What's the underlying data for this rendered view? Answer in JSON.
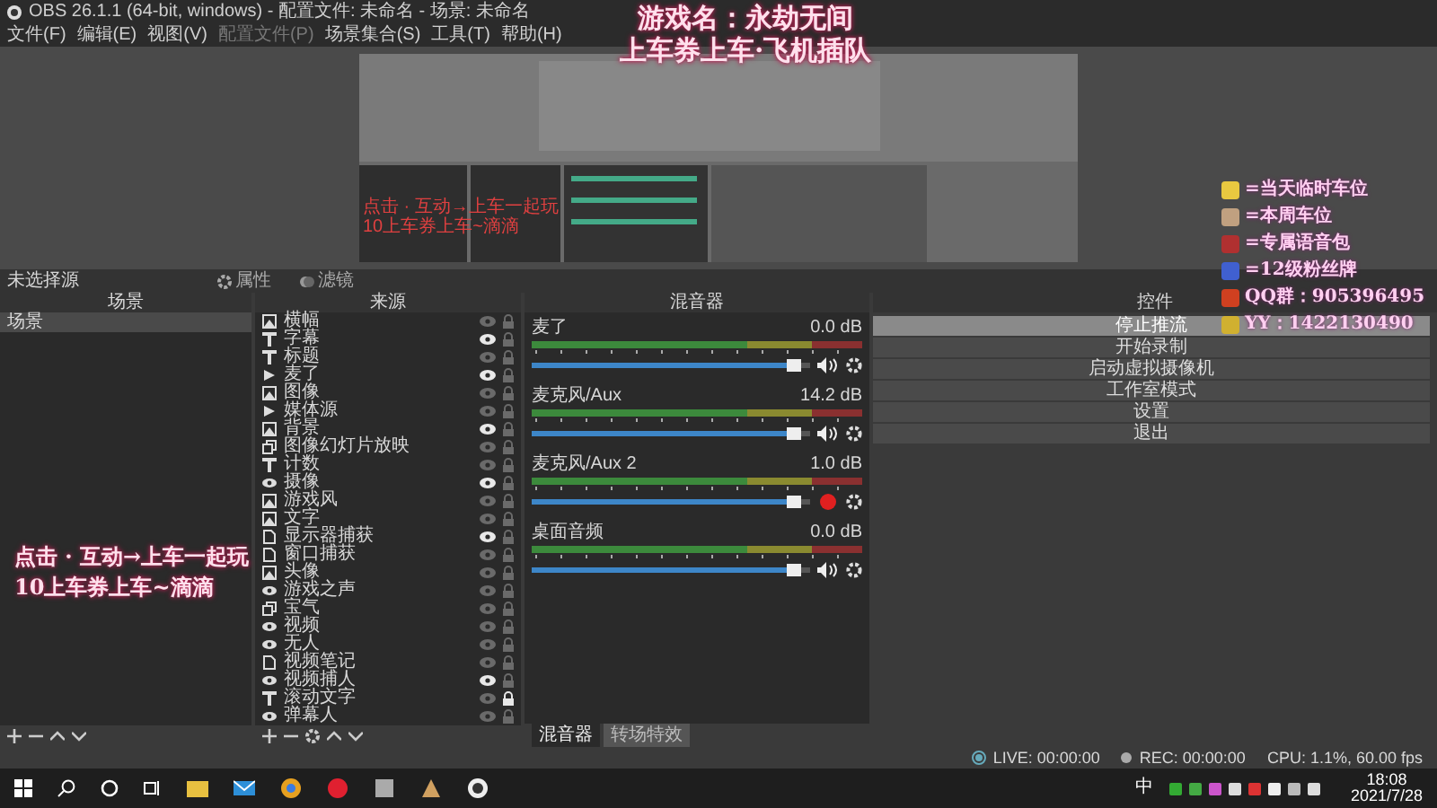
{
  "window": {
    "title": "OBS 26.1.1 (64-bit, windows) - 配置文件: 未命名 - 场景: 未命名"
  },
  "menu": [
    {
      "label": "文件(F)",
      "disabled": false
    },
    {
      "label": "编辑(E)",
      "disabled": false
    },
    {
      "label": "视图(V)",
      "disabled": false
    },
    {
      "label": "配置文件(P)",
      "disabled": true
    },
    {
      "label": "场景集合(S)",
      "disabled": false
    },
    {
      "label": "工具(T)",
      "disabled": false
    },
    {
      "label": "帮助(H)",
      "disabled": false
    }
  ],
  "overlay": {
    "headline": [
      "游戏名：永劫无间",
      "上车券上车·飞机插队"
    ],
    "promo_lines": [
      "点击 · 互动→上车一起玩",
      "10上车券上车~滴滴"
    ],
    "perks": [
      {
        "text": "=当天临时车位",
        "color": "#e8c840"
      },
      {
        "text": "=本周车位",
        "color": "#c0a080"
      },
      {
        "text": "=专属语音包",
        "color": "#b03030"
      },
      {
        "text": "=12级粉丝牌",
        "color": "#4060d0"
      },
      {
        "text": "QQ群：905396495",
        "color": "#d04020"
      },
      {
        "text": "YY：1422130490",
        "color": "#d0b030"
      }
    ]
  },
  "preview": {
    "overlay_lines": [
      "点击 · 互动→上车一起玩",
      "10上车券上车~滴滴"
    ]
  },
  "source_toolbar": {
    "label": "未选择源",
    "buttons": [
      "属性",
      "滤镜"
    ]
  },
  "scenes": {
    "title": "场景",
    "items": [
      {
        "label": "场景",
        "selected": true
      }
    ]
  },
  "sources": {
    "title": "来源",
    "items": [
      {
        "name": "横幅",
        "kind": "image",
        "visible": false,
        "locked": false
      },
      {
        "name": "字幕",
        "kind": "text",
        "visible": true,
        "locked": false
      },
      {
        "name": "标题",
        "kind": "text",
        "visible": false,
        "locked": false
      },
      {
        "name": "麦了",
        "kind": "media",
        "visible": true,
        "locked": false
      },
      {
        "name": "图像",
        "kind": "image",
        "visible": false,
        "locked": false
      },
      {
        "name": "媒体源",
        "kind": "media",
        "visible": false,
        "locked": false
      },
      {
        "name": "背景",
        "kind": "image",
        "visible": true,
        "locked": false
      },
      {
        "name": "图像幻灯片放映",
        "kind": "slideshow",
        "visible": false,
        "locked": false
      },
      {
        "name": "计数",
        "kind": "text",
        "visible": false,
        "locked": false
      },
      {
        "name": "摄像",
        "kind": "camera",
        "visible": true,
        "locked": false
      },
      {
        "name": "游戏风",
        "kind": "image",
        "visible": false,
        "locked": false
      },
      {
        "name": "文字",
        "kind": "image",
        "visible": false,
        "locked": false
      },
      {
        "name": "显示器捕获",
        "kind": "file",
        "visible": true,
        "locked": false
      },
      {
        "name": "窗口捕获",
        "kind": "file",
        "visible": false,
        "locked": false
      },
      {
        "name": "头像",
        "kind": "image",
        "visible": false,
        "locked": false
      },
      {
        "name": "游戏之声",
        "kind": "camera",
        "visible": false,
        "locked": false
      },
      {
        "name": "宝气",
        "kind": "slideshow",
        "visible": false,
        "locked": false
      },
      {
        "name": "视频",
        "kind": "camera",
        "visible": false,
        "locked": false
      },
      {
        "name": "无人",
        "kind": "camera",
        "visible": false,
        "locked": false
      },
      {
        "name": "视频笔记",
        "kind": "file",
        "visible": false,
        "locked": false
      },
      {
        "name": "视频捕人",
        "kind": "camera",
        "visible": true,
        "locked": false
      },
      {
        "name": "滚动文字",
        "kind": "text",
        "visible": false,
        "locked": true
      },
      {
        "name": "弹幕人",
        "kind": "camera",
        "visible": false,
        "locked": false
      }
    ]
  },
  "mixer": {
    "title": "混音器",
    "tracks": [
      {
        "name": "麦了",
        "reading": "0.0 dB",
        "level": 0.97,
        "muted": false
      },
      {
        "name": "麦克风/Aux",
        "reading": "14.2 dB",
        "level": 0.97,
        "muted": false
      },
      {
        "name": "麦克风/Aux 2",
        "reading": "1.0 dB",
        "level": 0.97,
        "muted": true
      },
      {
        "name": "桌面音频",
        "reading": "0.0 dB",
        "level": 0.97,
        "muted": false
      }
    ]
  },
  "dock_tabs": [
    {
      "label": "混音器",
      "selected": true
    },
    {
      "label": "转场特效",
      "selected": false
    }
  ],
  "controls": {
    "title": "控件",
    "buttons": [
      {
        "label": "停止推流",
        "selected": true
      },
      {
        "label": "开始录制",
        "selected": false
      },
      {
        "label": "启动虚拟摄像机",
        "selected": false
      },
      {
        "label": "工作室模式",
        "selected": false
      },
      {
        "label": "设置",
        "selected": false
      },
      {
        "label": "退出",
        "selected": false
      }
    ]
  },
  "status": {
    "live": "LIVE: 00:00:00",
    "rec": "REC: 00:00:00",
    "cpu": "CPU: 1.1%, 60.00 fps"
  },
  "tray": {
    "lang": "中"
  },
  "clock": {
    "time": "18:08",
    "date": "2021/7/28"
  }
}
